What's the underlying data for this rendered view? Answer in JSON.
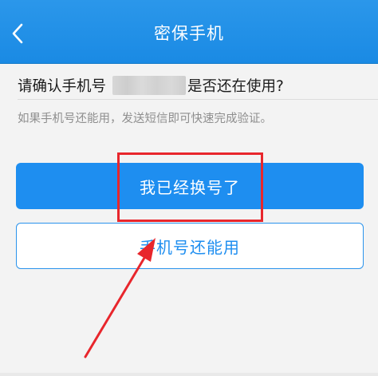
{
  "header": {
    "title": "密保手机",
    "back_icon": "chevron-left-icon"
  },
  "question": {
    "prefix": "请确认手机号",
    "suffix": "是否还在使用?"
  },
  "hint": "如果手机号还能用，发送短信即可快速完成验证。",
  "buttons": {
    "changed_number": "我已经换号了",
    "still_usable": "手机号还能用"
  },
  "colors": {
    "header_blue": "#1a8ae4",
    "primary_button": "#1e8ef0",
    "annotation_red": "#e8262c"
  }
}
